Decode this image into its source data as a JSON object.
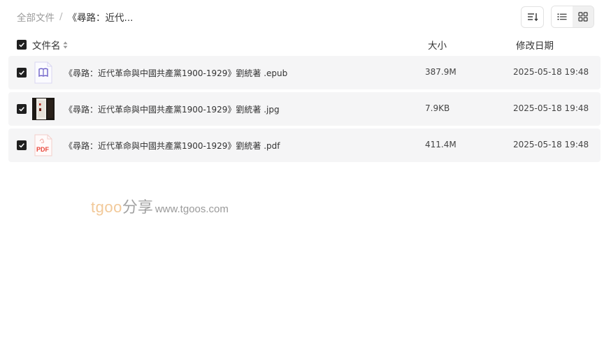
{
  "breadcrumb": {
    "root": "全部文件",
    "separator": "/",
    "current": "《尋路：近代..."
  },
  "toolbar": {
    "sort_icon": "sort-icon",
    "list_view_icon": "list-view-icon",
    "grid_view_icon": "grid-view-icon",
    "active_view": "list"
  },
  "table": {
    "headers": {
      "name": "文件名",
      "size": "大小",
      "date": "修改日期"
    },
    "select_all_checked": true,
    "rows": [
      {
        "name": "《尋路：近代革命與中國共產黨1900-1929》劉統著 .epub",
        "size": "387.9M",
        "date": "2025-05-18 19:48",
        "type": "epub",
        "checked": true
      },
      {
        "name": "《尋路：近代革命與中國共產黨1900-1929》劉統著 .jpg",
        "size": "7.9KB",
        "date": "2025-05-18 19:48",
        "type": "jpg",
        "checked": true
      },
      {
        "name": "《尋路：近代革命與中國共產黨1900-1929》劉統著 .pdf",
        "size": "411.4M",
        "date": "2025-05-18 19:48",
        "type": "pdf",
        "checked": true
      }
    ]
  },
  "watermark": {
    "brand": "tgoo",
    "share": "分享",
    "url": "www.tgoos.com"
  },
  "colors": {
    "row_background": "#f5f5f6",
    "checkbox": "#1f1f1f",
    "epub_accent": "#6f62c9",
    "pdf_accent": "#e8473a"
  }
}
